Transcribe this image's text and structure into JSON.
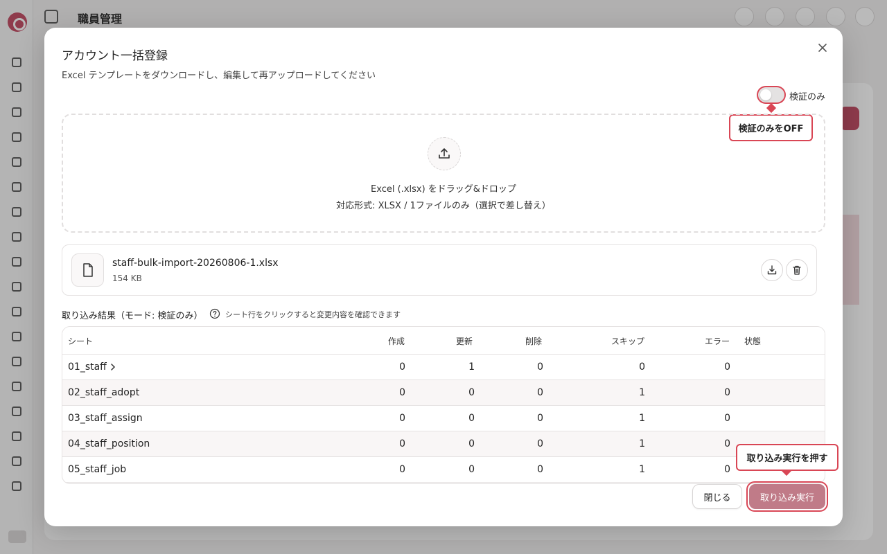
{
  "app": {
    "title": "職員管理"
  },
  "modal": {
    "title": "アカウント一括登録",
    "description": "Excel テンプレートをダウンロードし、編集して再アップロードしてください",
    "validate_only_label": "検証のみ",
    "validate_only_checked": false
  },
  "callouts": {
    "toggle": "検証のみをOFF",
    "run": "取り込み実行を押す"
  },
  "dropzone": {
    "main": "Excel (.xlsx) をドラッグ&ドロップ",
    "sub": "対応形式: XLSX / 1ファイルのみ（選択で差し替え）"
  },
  "file": {
    "name": "staff-bulk-import-20260806-1.xlsx",
    "size": "154 KB"
  },
  "results": {
    "title": "取り込み結果（モード: 検証のみ）",
    "hint": "シート行をクリックすると変更内容を確認できます",
    "columns": [
      "シート",
      "作成",
      "更新",
      "削除",
      "スキップ",
      "エラー",
      "状態"
    ],
    "rows": [
      {
        "sheet": "01_staff",
        "created": "0",
        "updated": "1",
        "deleted": "0",
        "skipped": "0",
        "errors": "0",
        "status": ""
      },
      {
        "sheet": "02_staff_adopt",
        "created": "0",
        "updated": "0",
        "deleted": "0",
        "skipped": "1",
        "errors": "0",
        "status": ""
      },
      {
        "sheet": "03_staff_assign",
        "created": "0",
        "updated": "0",
        "deleted": "0",
        "skipped": "1",
        "errors": "0",
        "status": ""
      },
      {
        "sheet": "04_staff_position",
        "created": "0",
        "updated": "0",
        "deleted": "0",
        "skipped": "1",
        "errors": "0",
        "status": ""
      },
      {
        "sheet": "05_staff_job",
        "created": "0",
        "updated": "0",
        "deleted": "0",
        "skipped": "1",
        "errors": "0",
        "status": ""
      }
    ]
  },
  "footer": {
    "close_label": "閉じる",
    "run_label": "取り込み実行"
  },
  "colors": {
    "accent": "#d94655",
    "run_button": "#c07b88"
  },
  "icons": {
    "close": "close-icon",
    "upload": "upload-icon",
    "file": "file-icon",
    "download": "download-icon",
    "delete": "trash-icon",
    "help": "help-circle-icon",
    "expand": "chevron-right-icon"
  }
}
